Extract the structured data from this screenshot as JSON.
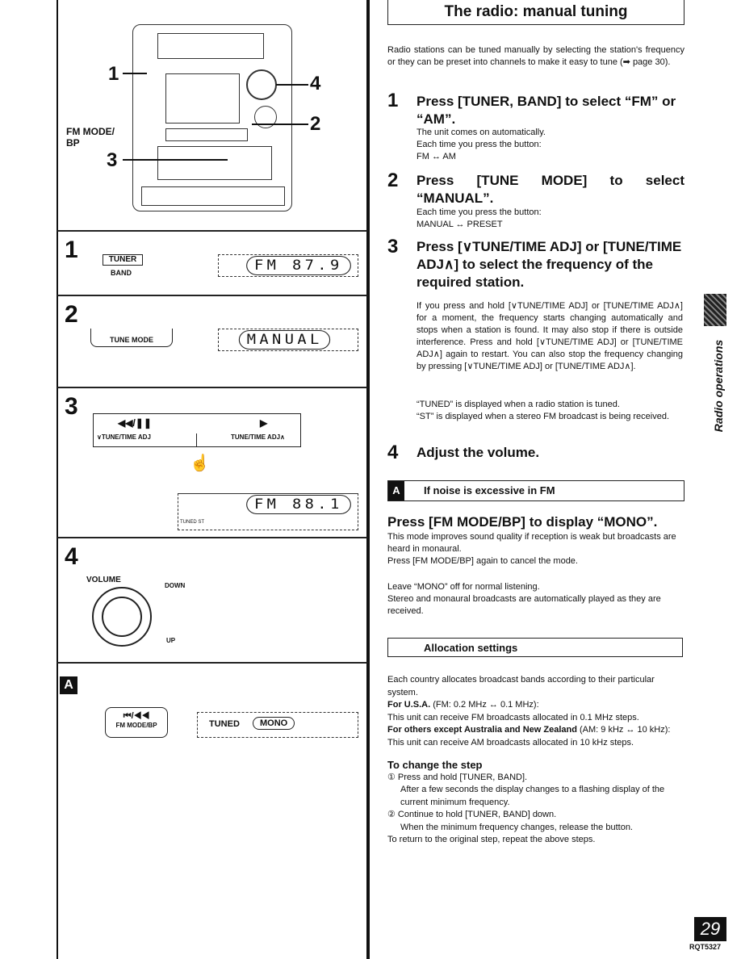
{
  "title": "The radio: manual tuning",
  "intro": "Radio stations can be tuned manually by selecting the station's frequency or they can be preset into channels to make it easy to tune (➡ page 30).",
  "steps": [
    {
      "num": "1",
      "heading": "Press [TUNER, BAND] to select “FM” or “AM”.",
      "lines": [
        "The unit comes on automatically.",
        "Each time you press the button:",
        "FM ↔ AM"
      ]
    },
    {
      "num": "2",
      "heading": "Press [TUNE MODE] to select “MANUAL”.",
      "lines": [
        "Each time you press the button:",
        "MANUAL ↔ PRESET"
      ]
    },
    {
      "num": "3",
      "heading": "Press [∨TUNE/TIME ADJ] or [TUNE/TIME ADJ∧] to select the frequency of the required station.",
      "p1": "If you press and hold [∨TUNE/TIME ADJ] or [TUNE/TIME ADJ∧] for a moment, the frequency starts changing automatically and stops when a station is found. It may also stop if there is outside interference. Press and hold [∨TUNE/TIME ADJ] or [TUNE/TIME ADJ∧] again to restart. You can also stop the frequency changing by pressing [∨TUNE/TIME ADJ] or [TUNE/TIME ADJ∧].",
      "p2": "“TUNED” is displayed when a radio station is tuned.",
      "p3": "“ST” is displayed when a stereo FM broadcast is being received."
    },
    {
      "num": "4",
      "heading": "Adjust the volume."
    }
  ],
  "sectionA": {
    "badge": "A",
    "title": "If noise is excessive in FM",
    "heading": "Press [FM MODE/BP] to display “MONO”.",
    "p1": "This mode improves sound quality if reception is weak but broadcasts are heard in monaural.",
    "p2": "Press [FM MODE/BP] again to cancel the mode.",
    "p3": "Leave “MONO” off for normal listening.",
    "p4": "Stereo and monaural broadcasts are automatically played as they are received."
  },
  "allocation": {
    "title": "Allocation settings",
    "p1": "Each country allocates broadcast bands according to their particular system.",
    "usa_bold": "For U.S.A.",
    "usa_rest": " (FM: 0.2 MHz ↔ 0.1 MHz):",
    "usa_text": "This unit can receive FM broadcasts allocated in 0.1 MHz steps.",
    "others_bold": "For others except Australia and New Zealand",
    "others_rest": " (AM: 9 kHz ↔ 10 kHz):",
    "others_text": "This unit can receive AM broadcasts allocated in 10 kHz steps.",
    "change_heading": "To change the step",
    "c1": "① Press and hold [TUNER, BAND].",
    "c1b": "After a few seconds the display changes to a flashing display of the current minimum frequency.",
    "c2": "② Continue to hold [TUNER, BAND] down.",
    "c2b": "When the minimum frequency changes, release the button.",
    "c3": "To return to the original step, repeat the above steps."
  },
  "side_tab": "Radio operations",
  "page_number": "29",
  "doc_code": "RQT5327",
  "left": {
    "callouts": [
      "1",
      "4",
      "2",
      "3"
    ],
    "fm_mode_label": "FM MODE/",
    "bp_label": "BP",
    "p1": {
      "num": "1",
      "button": "TUNER",
      "sub": "BAND",
      "display": "FM 87.9"
    },
    "p2": {
      "num": "2",
      "button": "TUNE MODE",
      "display": "MANUAL"
    },
    "p3": {
      "num": "3",
      "left_btn": "◀◀/❚❚",
      "left_label": "∨TUNE/TIME ADJ",
      "right_btn": "▶",
      "right_label": "TUNE/TIME ADJ∧",
      "display": "FM 88.1",
      "small": "TUNED ST"
    },
    "p4": {
      "num": "4",
      "volume": "VOLUME",
      "down": "DOWN",
      "up": "UP"
    },
    "pA": {
      "badge": "A",
      "button_icon": "⏮/◀◀",
      "button": "FM MODE/BP",
      "tuned": "TUNED",
      "mono": "MONO"
    }
  }
}
